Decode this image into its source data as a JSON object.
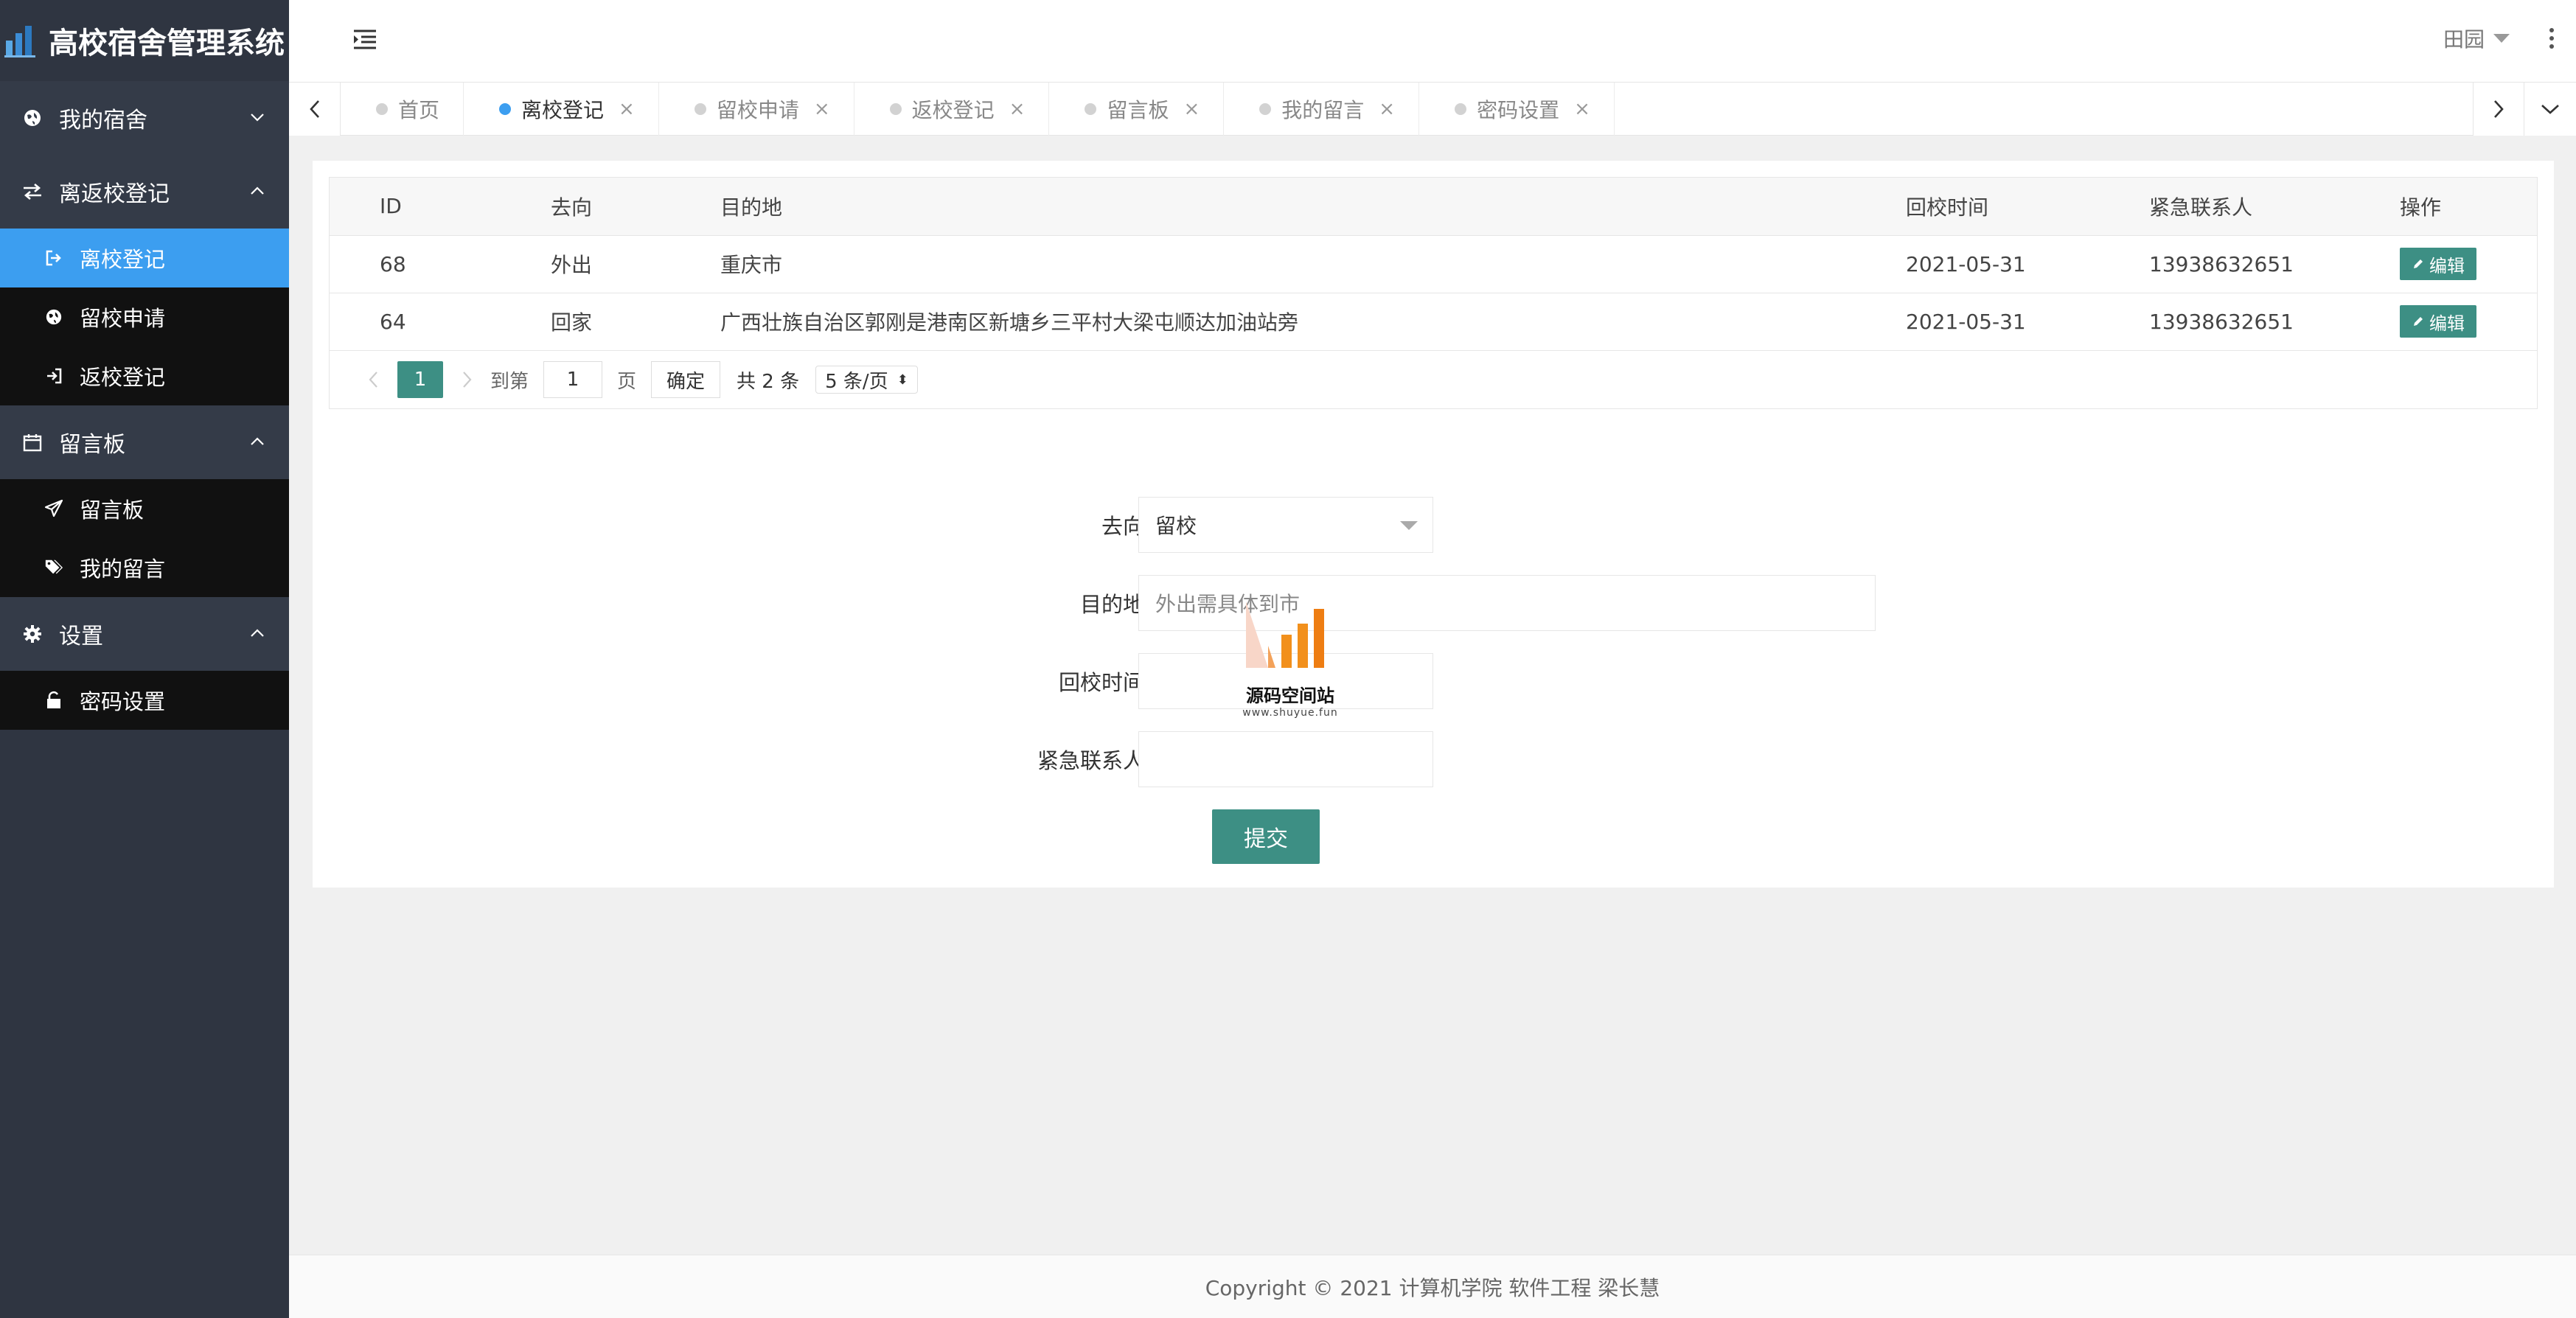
{
  "app": {
    "title": "高校宿舍管理系统"
  },
  "sidebar": {
    "groups": [
      {
        "label": "我的宿舍",
        "icon": "globe-icon",
        "expanded": false,
        "items": []
      },
      {
        "label": "离返校登记",
        "icon": "exchange-icon",
        "expanded": true,
        "items": [
          {
            "label": "离校登记",
            "icon": "sign-out-icon",
            "active": true
          },
          {
            "label": "留校申请",
            "icon": "globe-icon",
            "active": false
          },
          {
            "label": "返校登记",
            "icon": "sign-in-icon",
            "active": false
          }
        ]
      },
      {
        "label": "留言板",
        "icon": "calendar-icon",
        "expanded": true,
        "items": [
          {
            "label": "留言板",
            "icon": "paper-plane-icon",
            "active": false
          },
          {
            "label": "我的留言",
            "icon": "tags-icon",
            "active": false
          }
        ]
      },
      {
        "label": "设置",
        "icon": "gear-icon",
        "expanded": true,
        "items": [
          {
            "label": "密码设置",
            "icon": "unlock-icon",
            "active": false
          }
        ]
      }
    ]
  },
  "header": {
    "user_name": "田园"
  },
  "tabs": [
    {
      "label": "首页",
      "active": false,
      "closable": false
    },
    {
      "label": "离校登记",
      "active": true,
      "closable": true
    },
    {
      "label": "留校申请",
      "active": false,
      "closable": true
    },
    {
      "label": "返校登记",
      "active": false,
      "closable": true
    },
    {
      "label": "留言板",
      "active": false,
      "closable": true
    },
    {
      "label": "我的留言",
      "active": false,
      "closable": true
    },
    {
      "label": "密码设置",
      "active": false,
      "closable": true
    }
  ],
  "table": {
    "headers": [
      "ID",
      "去向",
      "目的地",
      "回校时间",
      "紧急联系人",
      "操作"
    ],
    "rows": [
      {
        "id": "68",
        "direction": "外出",
        "destination": "重庆市",
        "return_date": "2021-05-31",
        "contact": "13938632651",
        "action": "编辑"
      },
      {
        "id": "64",
        "direction": "回家",
        "destination": "广西壮族自治区郭刚是港南区新塘乡三平村大梁屯顺达加油站旁",
        "return_date": "2021-05-31",
        "contact": "13938632651",
        "action": "编辑"
      }
    ]
  },
  "pager": {
    "current_page": "1",
    "goto_label": "到第",
    "goto_value": "1",
    "page_unit": "页",
    "confirm_label": "确定",
    "total_label": "共 2 条",
    "page_size_label": "5 条/页"
  },
  "form": {
    "direction_label": "去向",
    "direction_value": "留校",
    "destination_label": "目的地",
    "destination_placeholder": "外出需具体到市",
    "return_label": "回校时间",
    "return_value": "",
    "contact_label": "紧急联系人",
    "contact_value": "",
    "submit_label": "提交"
  },
  "watermark": {
    "title": "源码空间站",
    "url": "www.shuyue.fun"
  },
  "footer": {
    "text": "Copyright © 2021 计算机学院 软件工程 梁长慧"
  },
  "colors": {
    "sidebar_bg": "#2f3541",
    "active": "#3c9ef0",
    "primary": "#3d8f84"
  }
}
